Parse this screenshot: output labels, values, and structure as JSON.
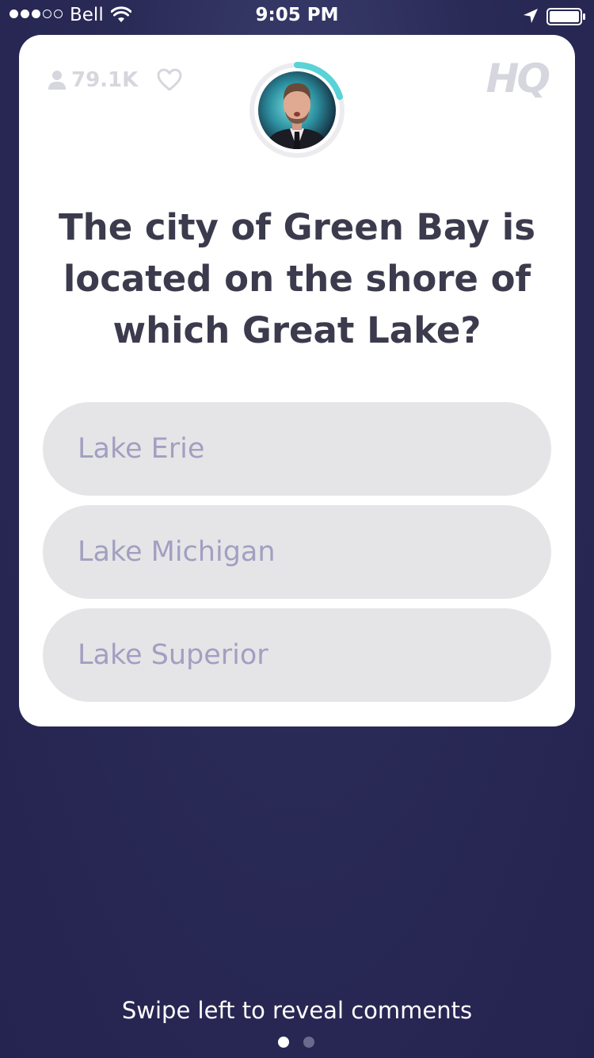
{
  "status_bar": {
    "carrier": "Bell",
    "time": "9:05 PM",
    "signal_filled": 3,
    "signal_total": 5
  },
  "header": {
    "viewer_count": "79.1K",
    "logo": "HQ",
    "icons": [
      "person-icon",
      "heart-icon",
      "location-arrow-icon",
      "battery-icon",
      "wifi-icon"
    ]
  },
  "question": {
    "text": "The city of Green Bay is located on the shore of which Great Lake?"
  },
  "answers": [
    {
      "label": "Lake Erie"
    },
    {
      "label": "Lake Michigan"
    },
    {
      "label": "Lake Superior"
    }
  ],
  "footer": {
    "hint": "Swipe left to reveal comments",
    "page_count": 2,
    "active_page": 1
  },
  "colors": {
    "background": "#2a2a56",
    "card": "#ffffff",
    "question_text": "#3b3b4d",
    "answer_bg": "#e5e5e7",
    "answer_text": "#a29fc1",
    "timer_ring": "#5ad2d6"
  }
}
